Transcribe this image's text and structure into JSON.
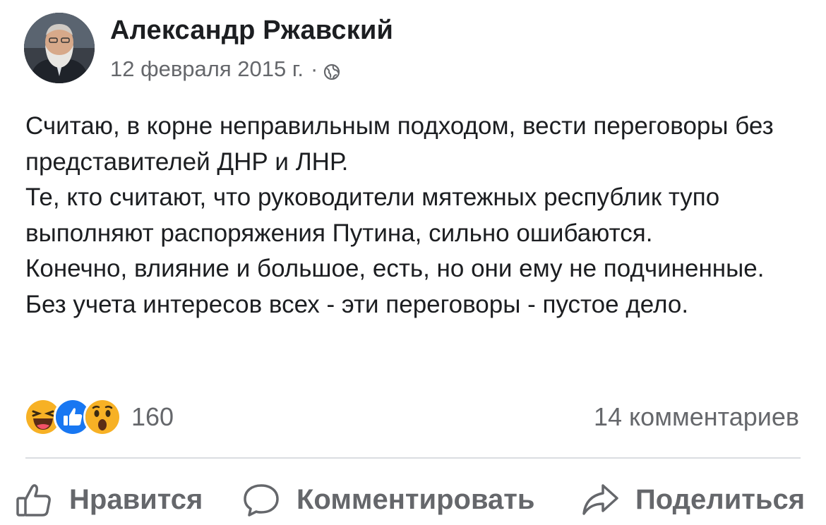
{
  "post": {
    "author": "Александр Ржавский",
    "date": "12 февраля 2015 г.",
    "separator": "·",
    "privacy_icon": "globe-icon",
    "text_lines": [
      "Считаю, в корне неправильным подходом, вести переговоры без представителей ДНР и ЛНР.",
      "Те, кто считают, что руководители мятежных республик тупо выполняют распоряжения Путина, сильно ошибаются.",
      "Конечно, влияние и большое, есть, но они ему не подчиненные.",
      "Без учета интересов всех - эти переговоры - пустое дело."
    ]
  },
  "reactions": {
    "icons": [
      "haha-reaction-icon",
      "like-reaction-icon",
      "wow-reaction-icon"
    ],
    "count": "160",
    "comments": "14 комментариев"
  },
  "actions": {
    "like_label": "Нравится",
    "comment_label": "Комментировать",
    "share_label": "Поделиться"
  },
  "colors": {
    "text": "#1c1e21",
    "secondary": "#65676b",
    "like_blue": "#1877f2",
    "reaction_yellow": "#f7b125",
    "divider": "#dadde1"
  }
}
